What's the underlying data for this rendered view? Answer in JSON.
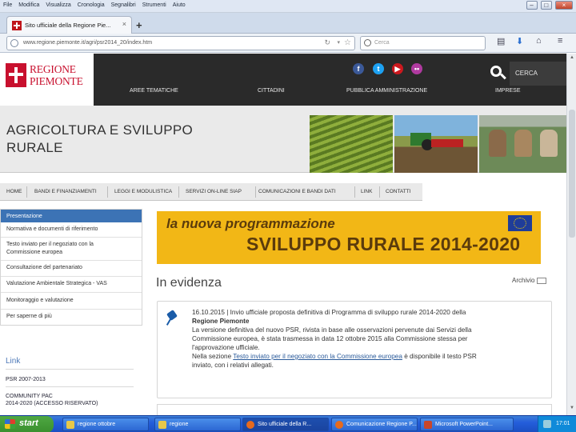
{
  "browser": {
    "menu": [
      "File",
      "Modifica",
      "Visualizza",
      "Cronologia",
      "Segnalibri",
      "Strumenti",
      "Aiuto"
    ],
    "tab_title": "Sito ufficiale della Regione Pie...",
    "tab_close": "×",
    "new_tab": "+",
    "url": "www.regione.piemonte.it/agri/psr2014_20/index.htm",
    "search_placeholder": "Cerca",
    "window_buttons": [
      "–",
      "□",
      "×"
    ]
  },
  "site": {
    "logo_line1": "REGIONE",
    "logo_line2": "PIEMONTE",
    "social": [
      {
        "icon": "facebook-icon",
        "glyph": "f",
        "color": "#3b5998"
      },
      {
        "icon": "twitter-icon",
        "glyph": "t",
        "color": "#1da1f2"
      },
      {
        "icon": "youtube-icon",
        "glyph": "▶",
        "color": "#cc181e"
      },
      {
        "icon": "flickr-icon",
        "glyph": "••",
        "color": "#b03aa0"
      }
    ],
    "main_nav": [
      "AREE TEMATICHE",
      "CITTADINI",
      "PUBBLICA AMMINISTRAZIONE",
      "IMPRESE"
    ],
    "search_label": "CERCA",
    "section_title_line1": "AGRICOLTURA E SVILUPPO",
    "section_title_line2": "RURALE",
    "sub_nav": [
      "HOME",
      "BANDI E FINANZIAMENTI",
      "LEGGI E MODULISTICA",
      "SERVIZI ON-LINE SIAP",
      "COMUNICAZIONI E BANDI DATI",
      "LINK",
      "CONTATTI"
    ]
  },
  "sidebar": {
    "items": [
      "Presentazione",
      "Normativa e documenti di riferimento",
      "Testo inviato per il negoziato con la",
      "Commissione europea",
      "Consultazione del partenariato",
      "Valutazione Ambientale Strategica - VAS",
      "Monitoraggio e valutazione",
      "Per saperne di più"
    ],
    "link_header": "Link",
    "links": [
      "PSR 2007-2013",
      "COMMUNITY PAC",
      "2014-2020 (ACCESSO RISERVATO)"
    ]
  },
  "main": {
    "banner_top": "la nuova programmazione",
    "banner_bottom": "SVILUPPO RURALE 2014-2020",
    "evidenza_title": "In evidenza",
    "archivio_label": "Archivio",
    "news": {
      "date": "16.10.2015",
      "headline": " | Invio ufficiale proposta definitiva di Programma di sviluppo rurale 2014-2020 della",
      "headline_bold": "Regione Piemonte",
      "line1": "La versione definitiva del nuovo PSR, rivista in base alle osservazioni pervenute dai Servizi della",
      "line2": "Commissione europea, è stata trasmessa in data 12 ottobre 2015 alla Commissione stessa per",
      "line3": "l'approvazione ufficiale.",
      "line4_pre": "Nella sezione ",
      "line4_link": "Testo inviato per il negoziato con la Commissione europea",
      "line4_post": " è disponibile il testo PSR",
      "line5": "inviato, con i relativi allegati."
    }
  },
  "taskbar": {
    "start": "start",
    "items": [
      {
        "label": "regione ottobre",
        "color": "#e8c84a"
      },
      {
        "label": "regione",
        "color": "#e8c84a"
      },
      {
        "label": "Sito ufficiale della R...",
        "color": "#e66a1e"
      },
      {
        "label": "Comunicazione Regione P...",
        "color": "#e66a1e"
      },
      {
        "label": "Microsoft PowerPoint...",
        "color": "#c8462a"
      }
    ],
    "clock": "17:01"
  }
}
